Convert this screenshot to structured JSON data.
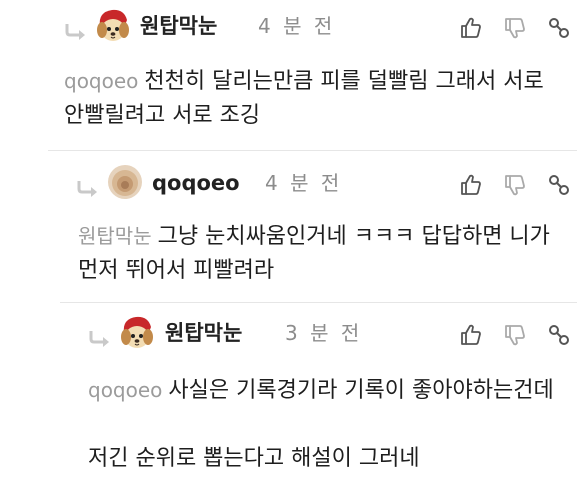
{
  "comments": [
    {
      "nickname": "원탑막눈",
      "time": "4 분 전",
      "avatar": "dog-character-icon",
      "mention": "qoqoeo",
      "text": "천천히 달리는만큼 피를 덜빨림 그래서 서로 안빨릴려고 서로 조깅"
    },
    {
      "nickname": "qoqoeo",
      "time": "4 분 전",
      "avatar": "blurred-avatar",
      "mention": "원탑막눈",
      "text": "그냥 눈치싸움인거네 ㅋㅋㅋ 답답하면 니가 먼저 뛰어서 피빨려라"
    },
    {
      "nickname": "원탑막눈",
      "time": "3 분 전",
      "avatar": "dog-character-icon",
      "mention": "qoqoeo",
      "text": "사실은 기록경기라 기록이 좋아야하는건데",
      "text2": "저긴 순위로 뽑는다고 해설이 그러네"
    }
  ],
  "actions": [
    "thumbs-up-icon",
    "thumbs-down-icon",
    "share-link-icon"
  ],
  "colors": {
    "mention": "#9b9b9b",
    "time": "#8c8c8c",
    "divider": "#e6e6e6",
    "icon": "#555555"
  }
}
